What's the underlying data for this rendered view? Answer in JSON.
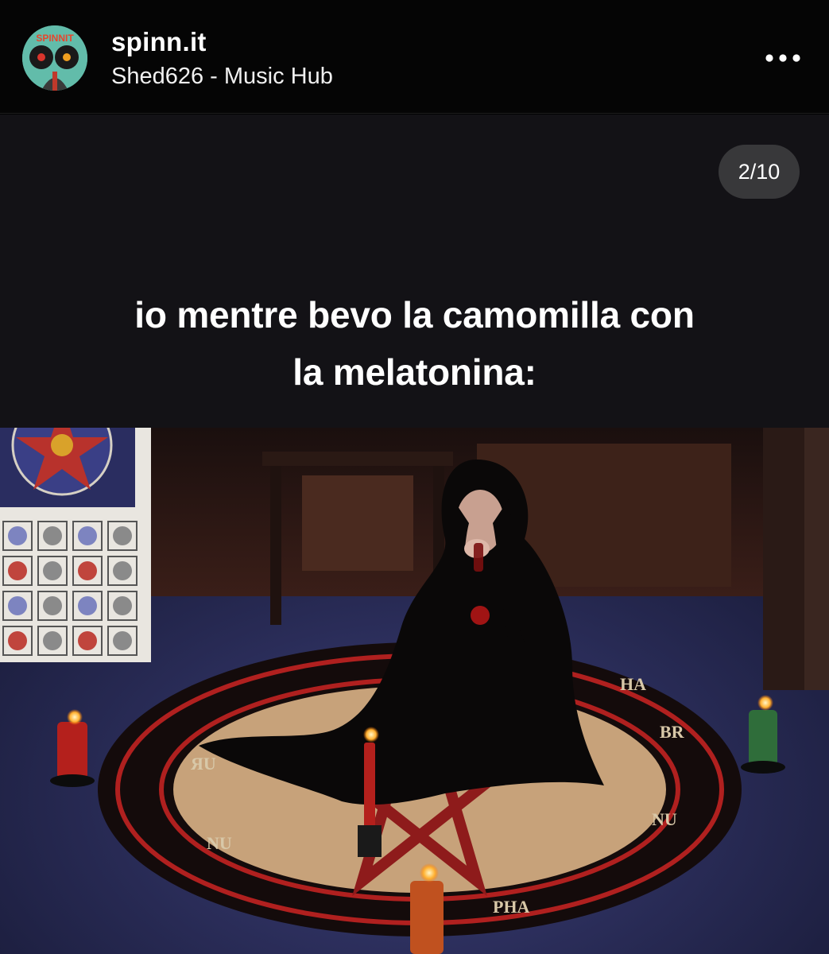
{
  "header": {
    "account_name": "spinn.it",
    "subtitle": "Shed626 - Music Hub",
    "avatar_text": "SPINNIT",
    "more_icon": "more-horizontal-icon"
  },
  "carousel": {
    "counter": "2/10"
  },
  "meme": {
    "line1": "io mentre bevo la camomilla con",
    "line2": "la melatonina:"
  },
  "colors": {
    "background": "#000000",
    "caption_bg": "#131216",
    "counter_bg": "#3c3c3e",
    "text": "#ffffff"
  }
}
